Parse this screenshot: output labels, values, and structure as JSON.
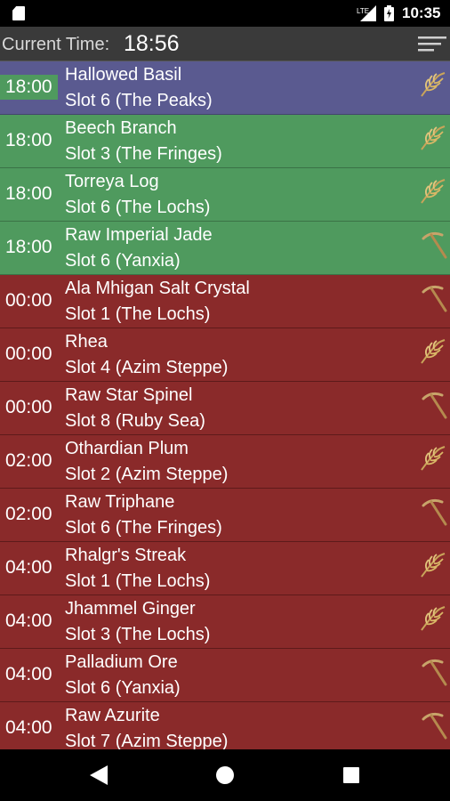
{
  "status_bar": {
    "network": "LTE",
    "clock": "10:35"
  },
  "toolbar": {
    "label": "Current Time:",
    "time": "18:56",
    "menu_icon": "sort-menu-icon"
  },
  "colors": {
    "ready": "#4f9a5e",
    "current": "#5a5a90",
    "later": "#8a2a2a"
  },
  "nodes": [
    {
      "time": "18:00",
      "name": "Hallowed Basil",
      "slot": "Slot 6 (The Peaks)",
      "tool": "sickle-icon",
      "state": "current"
    },
    {
      "time": "18:00",
      "name": "Beech Branch",
      "slot": "Slot 3 (The Fringes)",
      "tool": "sickle-icon",
      "state": "ready"
    },
    {
      "time": "18:00",
      "name": "Torreya Log",
      "slot": "Slot 6 (The Lochs)",
      "tool": "sickle-icon",
      "state": "ready"
    },
    {
      "time": "18:00",
      "name": "Raw Imperial Jade",
      "slot": "Slot 6 (Yanxia)",
      "tool": "pickaxe-icon",
      "state": "ready"
    },
    {
      "time": "00:00",
      "name": "Ala Mhigan Salt Crystal",
      "slot": "Slot 1 (The Lochs)",
      "tool": "pickaxe-icon",
      "state": "later"
    },
    {
      "time": "00:00",
      "name": "Rhea",
      "slot": "Slot 4 (Azim Steppe)",
      "tool": "sickle-icon",
      "state": "later"
    },
    {
      "time": "00:00",
      "name": "Raw Star Spinel",
      "slot": "Slot 8 (Ruby Sea)",
      "tool": "pickaxe-icon",
      "state": "later"
    },
    {
      "time": "02:00",
      "name": "Othardian Plum",
      "slot": "Slot 2 (Azim Steppe)",
      "tool": "sickle-icon",
      "state": "later"
    },
    {
      "time": "02:00",
      "name": "Raw Triphane",
      "slot": "Slot 6 (The Fringes)",
      "tool": "pickaxe-icon",
      "state": "later"
    },
    {
      "time": "04:00",
      "name": "Rhalgr's Streak",
      "slot": "Slot 1 (The Lochs)",
      "tool": "sickle-icon",
      "state": "later"
    },
    {
      "time": "04:00",
      "name": "Jhammel Ginger",
      "slot": "Slot 3 (The Lochs)",
      "tool": "sickle-icon",
      "state": "later"
    },
    {
      "time": "04:00",
      "name": "Palladium Ore",
      "slot": "Slot 6 (Yanxia)",
      "tool": "pickaxe-icon",
      "state": "later"
    },
    {
      "time": "04:00",
      "name": "Raw Azurite",
      "slot": "Slot 7 (Azim Steppe)",
      "tool": "pickaxe-icon",
      "state": "later"
    }
  ]
}
